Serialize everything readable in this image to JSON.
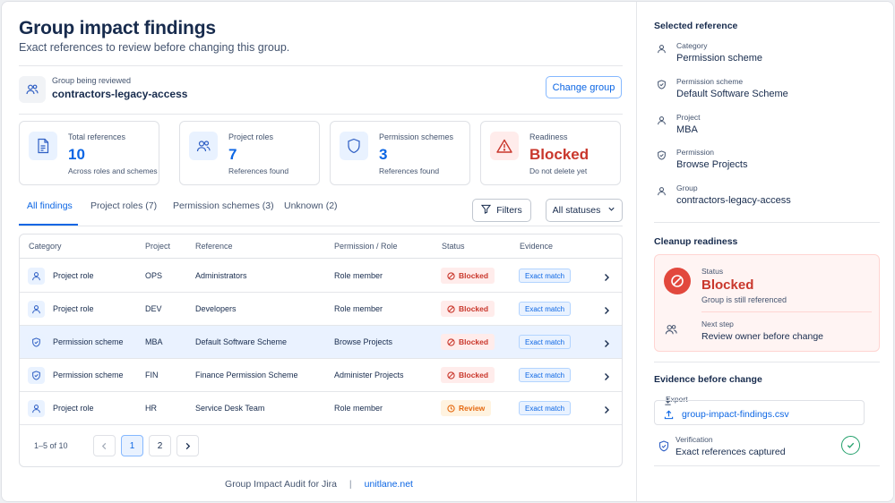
{
  "header": {
    "title": "Group impact findings",
    "subtitle": "Exact references to review before changing this group."
  },
  "group": {
    "label": "Group being reviewed",
    "value": "contractors-legacy-access",
    "change_button": "Change group"
  },
  "cards": [
    {
      "label": "Total references",
      "value": "10",
      "sub": "Across roles and schemes",
      "icon": "document-icon"
    },
    {
      "label": "Project roles",
      "value": "7",
      "sub": "References found",
      "icon": "users-icon"
    },
    {
      "label": "Permission schemes",
      "value": "3",
      "sub": "References found",
      "icon": "shield-icon"
    },
    {
      "label": "Readiness",
      "value": "Blocked",
      "sub": "Do not delete yet",
      "icon": "warning-icon"
    }
  ],
  "tabs": [
    {
      "label": "All findings",
      "active": true
    },
    {
      "label": "Project roles (7)"
    },
    {
      "label": "Permission schemes (3)"
    },
    {
      "label": "Unknown (2)"
    }
  ],
  "filters": {
    "filters_label": "Filters",
    "status_label": "All statuses"
  },
  "table": {
    "headers": [
      "Category",
      "Project",
      "Reference",
      "Permission / Role",
      "Status",
      "Evidence"
    ],
    "rows": [
      {
        "category": "Project role",
        "project": "OPS",
        "reference": "Administrators",
        "permission": "Role member",
        "status": "Blocked",
        "evidence": "Exact match",
        "icon": "user-icon"
      },
      {
        "category": "Project role",
        "project": "DEV",
        "reference": "Developers",
        "permission": "Role member",
        "status": "Blocked",
        "evidence": "Exact match",
        "icon": "user-icon"
      },
      {
        "category": "Permission scheme",
        "project": "MBA",
        "reference": "Default Software Scheme",
        "permission": "Browse Projects",
        "status": "Blocked",
        "evidence": "Exact match",
        "icon": "shield-icon",
        "selected": true
      },
      {
        "category": "Permission scheme",
        "project": "FIN",
        "reference": "Finance Permission Scheme",
        "permission": "Administer Projects",
        "status": "Blocked",
        "evidence": "Exact match",
        "icon": "shield-icon"
      },
      {
        "category": "Project role",
        "project": "HR",
        "reference": "Service Desk Team",
        "permission": "Role member",
        "status": "Review",
        "evidence": "Exact match",
        "icon": "user-icon"
      }
    ]
  },
  "pagination": {
    "info": "1–5 of 10",
    "pages": [
      "1",
      "2"
    ],
    "current": "1"
  },
  "footer": {
    "app_name": "Group Impact Audit for Jira",
    "separator": "|",
    "link": "unitlane.net"
  },
  "selected_reference": {
    "title": "Selected reference",
    "items": [
      {
        "label": "Category",
        "value": "Permission scheme",
        "icon": "user-icon"
      },
      {
        "label": "Permission scheme",
        "value": "Default Software Scheme",
        "icon": "shield-icon"
      },
      {
        "label": "Project",
        "value": "MBA",
        "icon": "user-icon"
      },
      {
        "label": "Permission",
        "value": "Browse Projects",
        "icon": "shield-icon"
      },
      {
        "label": "Group",
        "value": "contractors-legacy-access",
        "icon": "user-icon"
      }
    ]
  },
  "cleanup": {
    "title": "Cleanup readiness",
    "status_label": "Status",
    "status_value": "Blocked",
    "status_sub": "Group is still referenced",
    "next_label": "Next step",
    "next_value": "Review owner before change"
  },
  "evidence": {
    "title": "Evidence before change",
    "export_label": "Export",
    "export_file": "group-impact-findings.csv",
    "verification_label": "Verification",
    "verification_value": "Exact references captured"
  },
  "colors": {
    "accent": "#0c66e4",
    "danger": "#c9372c",
    "warning": "#e56910",
    "success": "#22a06b"
  }
}
